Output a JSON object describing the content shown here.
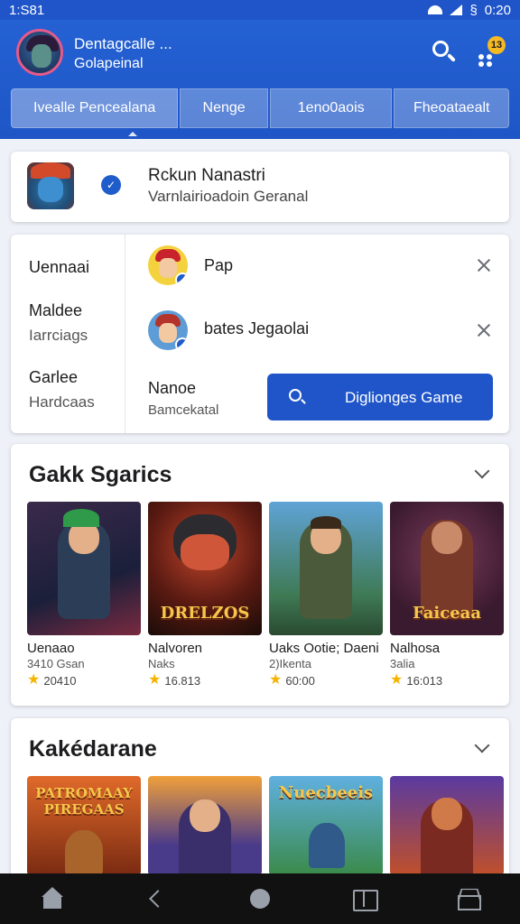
{
  "status_bar": {
    "time": "1:S81",
    "clock": "0:20",
    "battery_symbol": "§"
  },
  "header": {
    "title": "Dentagcalle ...",
    "subtitle": "Golapeinal",
    "notification_count": "13",
    "accent_color": "#1f55c9",
    "search_icon": "search-icon",
    "notification_icon": "notification-dots-icon"
  },
  "tabs": [
    {
      "label": "Ivealle Pencealana"
    },
    {
      "label": "Nenge"
    },
    {
      "label": "1eno0aois"
    },
    {
      "label": "Fheoataealt"
    }
  ],
  "featured": {
    "title": "Rckun Nanastri",
    "subtitle": "Varnlairioadoin Geranal",
    "badge_icon": "verified-icon"
  },
  "filters": {
    "left": [
      {
        "label": "Uennaai",
        "sub": ""
      },
      {
        "label": "Maldee",
        "sub": "Iarrciags"
      },
      {
        "label": "Garlee",
        "sub": "Hardcaas"
      }
    ],
    "chips": [
      {
        "label": "Pap"
      },
      {
        "label": "bates Jegaolai"
      }
    ],
    "bottom_label": "Nanoe",
    "bottom_sub": "Bamcekatal",
    "button_label": "Diglionges Game"
  },
  "sections": [
    {
      "title": "Gakk Sgarics",
      "games": [
        {
          "name": "Uenaao",
          "meta": "3410 Gsan",
          "rating": "20410",
          "art_text": ""
        },
        {
          "name": "Nalvoren",
          "meta": "Naks",
          "rating": "16.813",
          "art_text": "DRELZOS"
        },
        {
          "name": "Uaks Ootie; Daeni",
          "meta": "2)Ikenta",
          "rating": "60:00",
          "art_text": ""
        },
        {
          "name": "Nalhosa",
          "meta": "3alia",
          "rating": "16:013",
          "art_text": "Faiceaa"
        }
      ]
    },
    {
      "title": "Kakédarane",
      "games": [
        {
          "art_text": "PATROMAAY PIREGAAS"
        },
        {
          "art_text": ""
        },
        {
          "art_text": "Nuecbeeis"
        },
        {
          "art_text": ""
        }
      ]
    }
  ],
  "nav": [
    {
      "icon": "home-icon"
    },
    {
      "icon": "back-icon"
    },
    {
      "icon": "home-circle-icon"
    },
    {
      "icon": "library-icon"
    },
    {
      "icon": "inbox-icon"
    }
  ]
}
